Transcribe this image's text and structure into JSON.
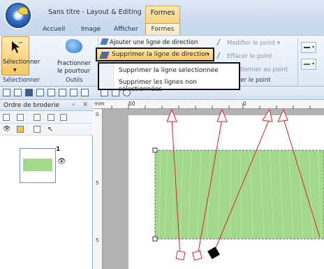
{
  "window": {
    "title": "Sans titre - Layout & Editing",
    "context_tab_group": "Formes"
  },
  "ribbon": {
    "tabs": [
      {
        "label": "Accueil",
        "active": false
      },
      {
        "label": "Image",
        "active": false
      },
      {
        "label": "Afficher",
        "active": false
      },
      {
        "label": "Formes",
        "active": true
      }
    ],
    "select_button": "Sélectionner",
    "fraction_button_line1": "Fractionner",
    "fraction_button_line2": "le pourtour",
    "add_direction_line": "Ajouter une ligne de direction",
    "remove_direction_line": "Supprimer la ligne de direction",
    "modify_point": "Modifier le point",
    "erase_point": "Effacer le point",
    "add_point_partial": "tionner au point",
    "group_selection": "Sélectionner",
    "group_tools": "Outils",
    "group_point_partial": "ter le point"
  },
  "dropdown_menu": {
    "items": [
      "Supprimer la ligne sélectionnée",
      "Supprimer les lignes non sélectionnées"
    ]
  },
  "panel": {
    "title": "Ordre de broderie",
    "pin": "ᵖ",
    "close": "×",
    "item_number": "1"
  },
  "ruler": {
    "unit": "mm",
    "labels": [
      "50",
      "0"
    ],
    "vertical_labels": [
      "0",
      "5",
      "5"
    ]
  },
  "colors": {
    "fill_green": "#a3d98d",
    "direction_line_red": "#e02020",
    "highlight_orange": "#f7c965"
  },
  "icons": [
    "app-orb-icon",
    "select-arrow-icon",
    "fraction-outline-icon",
    "direction-line-icon",
    "remove-direction-line-icon",
    "modify-point-icon",
    "erase-point-icon",
    "eye-icon"
  ]
}
